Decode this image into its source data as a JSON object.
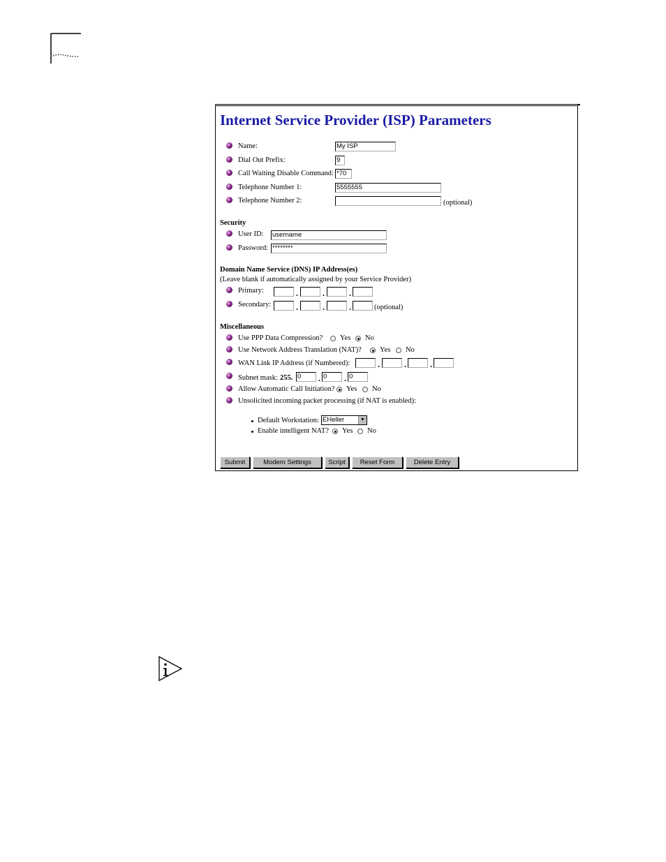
{
  "page_title": "Internet Service Provider (ISP) Parameters",
  "fields": {
    "name": {
      "label": "Name:",
      "value": "My ISP"
    },
    "dial_out_prefix": {
      "label": "Dial Out Prefix:",
      "value": "9"
    },
    "call_waiting": {
      "label": "Call Waiting Disable Command:",
      "value": "*70"
    },
    "tel1": {
      "label": "Telephone Number 1:",
      "value": "5555555"
    },
    "tel2": {
      "label": "Telephone Number 2:",
      "value": "",
      "note": "(optional)"
    }
  },
  "security": {
    "heading": "Security",
    "user_id": {
      "label": "User ID:",
      "value": "username"
    },
    "password": {
      "label": "Password:",
      "value": "********"
    }
  },
  "dns": {
    "heading": "Domain Name Service (DNS) IP Address(es)",
    "subheading": "(Leave blank if automatically assigned by your Service Provider)",
    "primary_label": "Primary:",
    "secondary_label": "Secondary:",
    "secondary_note": "(optional)",
    "separator": "."
  },
  "misc": {
    "heading": "Miscellaneous",
    "ppp_label": "Use PPP Data Compression?",
    "nat_label": "Use Network Address Translation (NAT)?",
    "wan_label": "WAN Link IP Address (if Numbered):",
    "subnet_label": "Subnet mask:",
    "subnet_prefix": "255.",
    "subnet_values": [
      "0",
      "0",
      "0"
    ],
    "auto_call_label": "Allow Automatic Call Initiation?",
    "unsolicited_label": "Unsolicited incoming packet processing (if NAT is enabled):",
    "default_ws_label": "Default Workstation:",
    "default_ws_value": "EHeller",
    "intelligent_nat_label": "Enable intelligent NAT?",
    "yes": "Yes",
    "no": "No"
  },
  "buttons": {
    "submit": "Submit",
    "modem": "Modem Settings",
    "script": "Script",
    "reset": "Reset Form",
    "delete": "Delete Entry"
  },
  "icons": [
    "bullet-icon",
    "info-icon",
    "chevron-down-icon"
  ]
}
